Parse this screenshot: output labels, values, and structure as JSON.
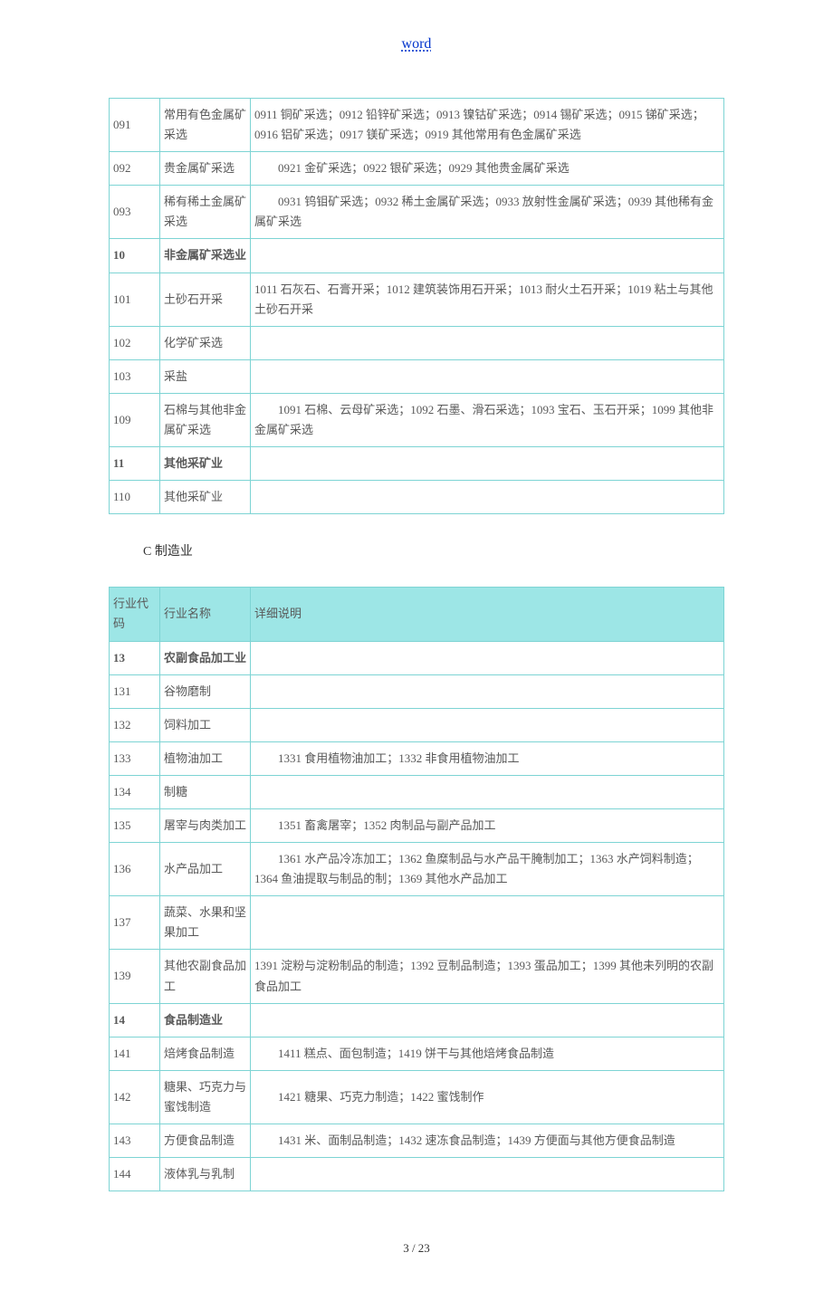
{
  "header": {
    "link_text": "word"
  },
  "table1": {
    "rows": [
      {
        "code": "091",
        "name": "常用有色金属矿采选",
        "desc": "0911 铜矿采选；0912 铅锌矿采选；0913 镍钴矿采选；0914 锡矿采选；0915 锑矿采选；0916 铝矿采选；0917 镁矿采选；0919 其他常用有色金属矿采选"
      },
      {
        "code": "092",
        "name": "贵金属矿采选",
        "desc": "　　0921 金矿采选；0922 银矿采选；0929 其他贵金属矿采选"
      },
      {
        "code": "093",
        "name": "稀有稀土金属矿采选",
        "desc": "　　0931 钨钼矿采选；0932 稀土金属矿采选；0933 放射性金属矿采选；0939 其他稀有金属矿采选"
      },
      {
        "code": "10",
        "name": "非金属矿采选业",
        "desc": "",
        "bold": true
      },
      {
        "code": "101",
        "name": "土砂石开采",
        "desc": "1011 石灰石、石膏开采；1012 建筑装饰用石开采；1013 耐火土石开采；1019 粘土与其他土砂石开采"
      },
      {
        "code": "102",
        "name": "化学矿采选",
        "desc": ""
      },
      {
        "code": "103",
        "name": "采盐",
        "desc": ""
      },
      {
        "code": "109",
        "name": "石棉与其他非金属矿采选",
        "desc": "　　1091 石棉、云母矿采选；1092 石墨、滑石采选；1093 宝石、玉石开采；1099 其他非金属矿采选"
      },
      {
        "code": "11",
        "name": "其他采矿业",
        "desc": "",
        "bold": true
      },
      {
        "code": "110",
        "name": "其他采矿业",
        "desc": ""
      }
    ]
  },
  "section_title": "C 制造业",
  "table2": {
    "header": {
      "code": "行业代码",
      "name": "行业名称",
      "desc": "详细说明"
    },
    "rows": [
      {
        "code": "13",
        "name": "农副食品加工业",
        "desc": "",
        "bold": true
      },
      {
        "code": "131",
        "name": "谷物磨制",
        "desc": ""
      },
      {
        "code": "132",
        "name": "饲料加工",
        "desc": ""
      },
      {
        "code": "133",
        "name": "植物油加工",
        "desc": "　　1331 食用植物油加工；1332 非食用植物油加工"
      },
      {
        "code": "134",
        "name": "制糖",
        "desc": ""
      },
      {
        "code": "135",
        "name": "屠宰与肉类加工",
        "desc": "　　1351 畜禽屠宰；1352 肉制品与副产品加工"
      },
      {
        "code": "136",
        "name": "水产品加工",
        "desc": "　　1361 水产品冷冻加工；1362 鱼糜制品与水产品干腌制加工；1363 水产饲料制造；1364 鱼油提取与制品的制；1369 其他水产品加工"
      },
      {
        "code": "137",
        "name": "蔬菜、水果和坚果加工",
        "desc": ""
      },
      {
        "code": "139",
        "name": "其他农副食品加工",
        "desc": "1391 淀粉与淀粉制品的制造；1392 豆制品制造；1393 蛋品加工；1399 其他未列明的农副食品加工"
      },
      {
        "code": "14",
        "name": "食品制造业",
        "desc": "",
        "bold": true
      },
      {
        "code": "141",
        "name": "焙烤食品制造",
        "desc": "　　1411 糕点、面包制造；1419 饼干与其他焙烤食品制造"
      },
      {
        "code": "142",
        "name": "糖果、巧克力与蜜饯制造",
        "desc": "　　1421 糖果、巧克力制造；1422 蜜饯制作"
      },
      {
        "code": "143",
        "name": "方便食品制造",
        "desc": "　　1431 米、面制品制造；1432 速冻食品制造；1439 方便面与其他方便食品制造"
      },
      {
        "code": "144",
        "name": "液体乳与乳制",
        "desc": ""
      }
    ]
  },
  "footer": {
    "page": "3 / 23"
  }
}
